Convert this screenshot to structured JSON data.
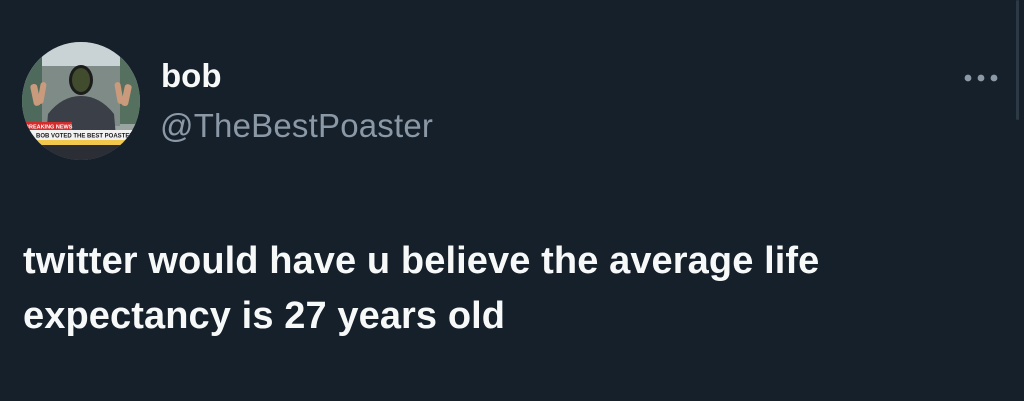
{
  "tweet": {
    "author": {
      "display_name": "bob",
      "handle": "@TheBestPoaster",
      "avatar": {
        "breaking_label": "BREAKING NEWS",
        "headline": "BOB VOTED THE BEST POASTER"
      }
    },
    "text": "twitter would have u believe the average life expectancy is 27 years old",
    "more_icon": "more-horizontal-icon"
  },
  "theme": {
    "background": "#15202b",
    "text_primary": "#f7f9f9",
    "text_secondary": "#8b98a5"
  }
}
